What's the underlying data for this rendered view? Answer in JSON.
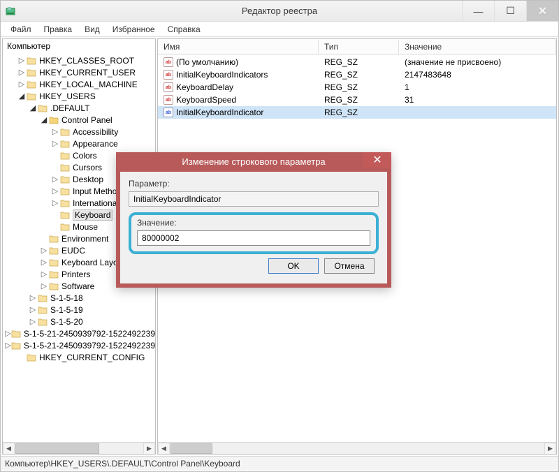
{
  "window": {
    "title": "Редактор реестра"
  },
  "menu": {
    "file": "Файл",
    "edit": "Правка",
    "view": "Вид",
    "favorites": "Избранное",
    "help": "Справка"
  },
  "tree": {
    "root": "Компьютер",
    "items": [
      {
        "label": "HKEY_CLASSES_ROOT",
        "depth": 1,
        "tw": "▷"
      },
      {
        "label": "HKEY_CURRENT_USER",
        "depth": 1,
        "tw": "▷"
      },
      {
        "label": "HKEY_LOCAL_MACHINE",
        "depth": 1,
        "tw": "▷"
      },
      {
        "label": "HKEY_USERS",
        "depth": 1,
        "tw": "◢"
      },
      {
        "label": ".DEFAULT",
        "depth": 2,
        "tw": "◢"
      },
      {
        "label": "Control Panel",
        "depth": 3,
        "tw": "◢",
        "open": true
      },
      {
        "label": "Accessibility",
        "depth": 4,
        "tw": "▷"
      },
      {
        "label": "Appearance",
        "depth": 4,
        "tw": "▷"
      },
      {
        "label": "Colors",
        "depth": 4,
        "tw": ""
      },
      {
        "label": "Cursors",
        "depth": 4,
        "tw": ""
      },
      {
        "label": "Desktop",
        "depth": 4,
        "tw": "▷"
      },
      {
        "label": "Input Method",
        "depth": 4,
        "tw": "▷"
      },
      {
        "label": "International",
        "depth": 4,
        "tw": "▷"
      },
      {
        "label": "Keyboard",
        "depth": 4,
        "tw": "",
        "selected": true
      },
      {
        "label": "Mouse",
        "depth": 4,
        "tw": ""
      },
      {
        "label": "Environment",
        "depth": 3,
        "tw": ""
      },
      {
        "label": "EUDC",
        "depth": 3,
        "tw": "▷"
      },
      {
        "label": "Keyboard Layout",
        "depth": 3,
        "tw": "▷"
      },
      {
        "label": "Printers",
        "depth": 3,
        "tw": "▷"
      },
      {
        "label": "Software",
        "depth": 3,
        "tw": "▷"
      },
      {
        "label": "S-1-5-18",
        "depth": 2,
        "tw": "▷"
      },
      {
        "label": "S-1-5-19",
        "depth": 2,
        "tw": "▷"
      },
      {
        "label": "S-1-5-20",
        "depth": 2,
        "tw": "▷"
      },
      {
        "label": "S-1-5-21-2450939792-1522492239",
        "depth": 2,
        "tw": "▷"
      },
      {
        "label": "S-1-5-21-2450939792-1522492239",
        "depth": 2,
        "tw": "▷"
      },
      {
        "label": "HKEY_CURRENT_CONFIG",
        "depth": 1,
        "tw": ""
      }
    ]
  },
  "list": {
    "headers": {
      "name": "Имя",
      "type": "Тип",
      "value": "Значение"
    },
    "rows": [
      {
        "name": "(По умолчанию)",
        "type": "REG_SZ",
        "value": "(значение не присвоено)",
        "icon": "ab"
      },
      {
        "name": "InitialKeyboardIndicators",
        "type": "REG_SZ",
        "value": "2147483648",
        "icon": "ab"
      },
      {
        "name": "KeyboardDelay",
        "type": "REG_SZ",
        "value": "1",
        "icon": "ab"
      },
      {
        "name": "KeyboardSpeed",
        "type": "REG_SZ",
        "value": "31",
        "icon": "ab"
      },
      {
        "name": "InitialKeyboardIndicator",
        "type": "REG_SZ",
        "value": "",
        "icon": "ab",
        "selected": true,
        "blue": true
      }
    ]
  },
  "status": {
    "path": "Компьютер\\HKEY_USERS\\.DEFAULT\\Control Panel\\Keyboard"
  },
  "dialog": {
    "title": "Изменение строкового параметра",
    "param_label": "Параметр:",
    "param_value": "InitialKeyboardIndicator",
    "value_label": "Значение:",
    "value_value": "80000002",
    "ok": "OK",
    "cancel": "Отмена"
  }
}
